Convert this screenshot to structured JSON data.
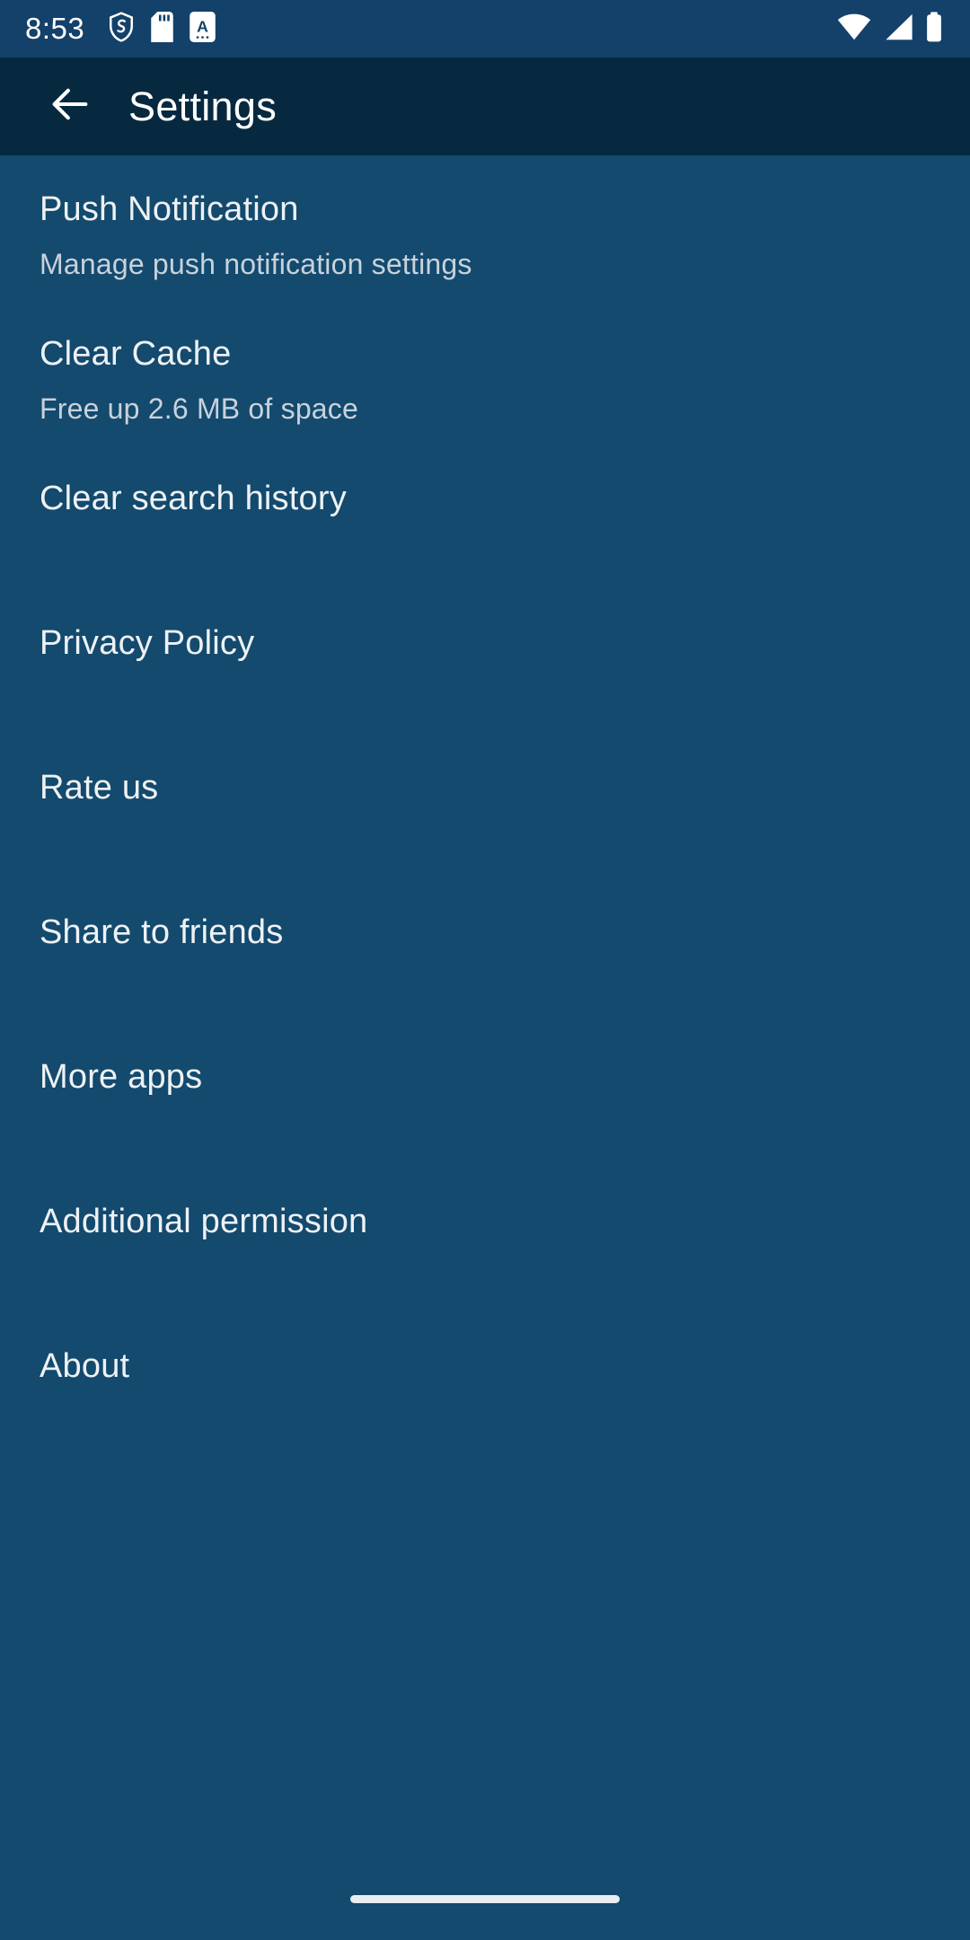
{
  "status_bar": {
    "time": "8:53",
    "left_icons": [
      "shield-icon",
      "sd-card-icon",
      "app-badge-a-icon"
    ],
    "app_badge_letter": "A",
    "right_icons": [
      "wifi-icon",
      "cellular-signal-icon",
      "battery-icon"
    ],
    "background_color": "#13416a"
  },
  "app_bar": {
    "back_icon": "arrow-left-icon",
    "title": "Settings",
    "background_color": "#06293f"
  },
  "theme": {
    "page_background": "#134a6e",
    "title_text": "#eef1f4",
    "subtitle_text": "#c8d2dc"
  },
  "settings_items": [
    {
      "title": "Push Notification",
      "subtitle": "Manage push notification settings"
    },
    {
      "title": "Clear Cache",
      "subtitle": "Free up 2.6 MB of space"
    },
    {
      "title": "Clear search history",
      "subtitle": ""
    },
    {
      "title": "Privacy Policy",
      "subtitle": ""
    },
    {
      "title": "Rate us",
      "subtitle": ""
    },
    {
      "title": "Share to friends",
      "subtitle": ""
    },
    {
      "title": "More apps",
      "subtitle": ""
    },
    {
      "title": "Additional permission",
      "subtitle": ""
    },
    {
      "title": "About",
      "subtitle": ""
    }
  ],
  "nav_bar": {
    "gesture_pill": "home-gesture-pill"
  }
}
